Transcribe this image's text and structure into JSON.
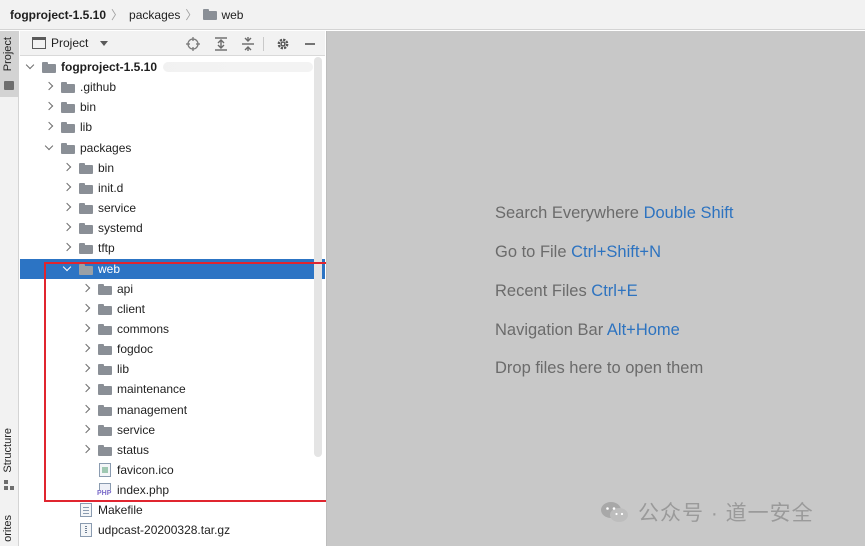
{
  "breadcrumb": {
    "items": [
      "fogproject-1.5.10",
      "packages",
      "web"
    ]
  },
  "tool_strip": {
    "project_tab": "Project",
    "structure_tab": "Structure",
    "favorites_tab": "orites"
  },
  "panel": {
    "view_selector": "Project",
    "tree": [
      {
        "label": "fogproject-1.5.10",
        "kind": "folder",
        "depth": 0,
        "expanded": true,
        "root": true
      },
      {
        "label": ".github",
        "kind": "folder",
        "depth": 1,
        "expanded": false
      },
      {
        "label": "bin",
        "kind": "folder",
        "depth": 1,
        "expanded": false
      },
      {
        "label": "lib",
        "kind": "folder",
        "depth": 1,
        "expanded": false
      },
      {
        "label": "packages",
        "kind": "folder",
        "depth": 1,
        "expanded": true
      },
      {
        "label": "bin",
        "kind": "folder",
        "depth": 2,
        "expanded": false
      },
      {
        "label": "init.d",
        "kind": "folder",
        "depth": 2,
        "expanded": false
      },
      {
        "label": "service",
        "kind": "folder",
        "depth": 2,
        "expanded": false
      },
      {
        "label": "systemd",
        "kind": "folder",
        "depth": 2,
        "expanded": false
      },
      {
        "label": "tftp",
        "kind": "folder",
        "depth": 2,
        "expanded": false
      },
      {
        "label": "web",
        "kind": "folder",
        "depth": 2,
        "expanded": true,
        "selected": true
      },
      {
        "label": "api",
        "kind": "folder",
        "depth": 3,
        "expanded": false
      },
      {
        "label": "client",
        "kind": "folder",
        "depth": 3,
        "expanded": false
      },
      {
        "label": "commons",
        "kind": "folder",
        "depth": 3,
        "expanded": false
      },
      {
        "label": "fogdoc",
        "kind": "folder",
        "depth": 3,
        "expanded": false
      },
      {
        "label": "lib",
        "kind": "folder",
        "depth": 3,
        "expanded": false
      },
      {
        "label": "maintenance",
        "kind": "folder",
        "depth": 3,
        "expanded": false
      },
      {
        "label": "management",
        "kind": "folder",
        "depth": 3,
        "expanded": false
      },
      {
        "label": "service",
        "kind": "folder",
        "depth": 3,
        "expanded": false
      },
      {
        "label": "status",
        "kind": "folder",
        "depth": 3,
        "expanded": false
      },
      {
        "label": "favicon.ico",
        "kind": "ico",
        "depth": 3
      },
      {
        "label": "index.php",
        "kind": "php",
        "depth": 3
      },
      {
        "label": "Makefile",
        "kind": "make",
        "depth": 2
      },
      {
        "label": "udpcast-20200328.tar.gz",
        "kind": "arch",
        "depth": 2
      }
    ]
  },
  "editor": {
    "hints": [
      {
        "text": "Search Everywhere",
        "shortcut": "Double Shift"
      },
      {
        "text": "Go to File",
        "shortcut": "Ctrl+Shift+N"
      },
      {
        "text": "Recent Files",
        "shortcut": "Ctrl+E"
      },
      {
        "text": "Navigation Bar",
        "shortcut": "Alt+Home"
      },
      {
        "text": "Drop files here to open them",
        "shortcut": ""
      }
    ]
  },
  "watermark": {
    "text": "公众号 · 道一安全"
  },
  "colors": {
    "selection": "#2c74c4",
    "shortcut": "#2d73c0",
    "annotation": "#e0252f",
    "editor_bg": "#c8c8c8"
  }
}
